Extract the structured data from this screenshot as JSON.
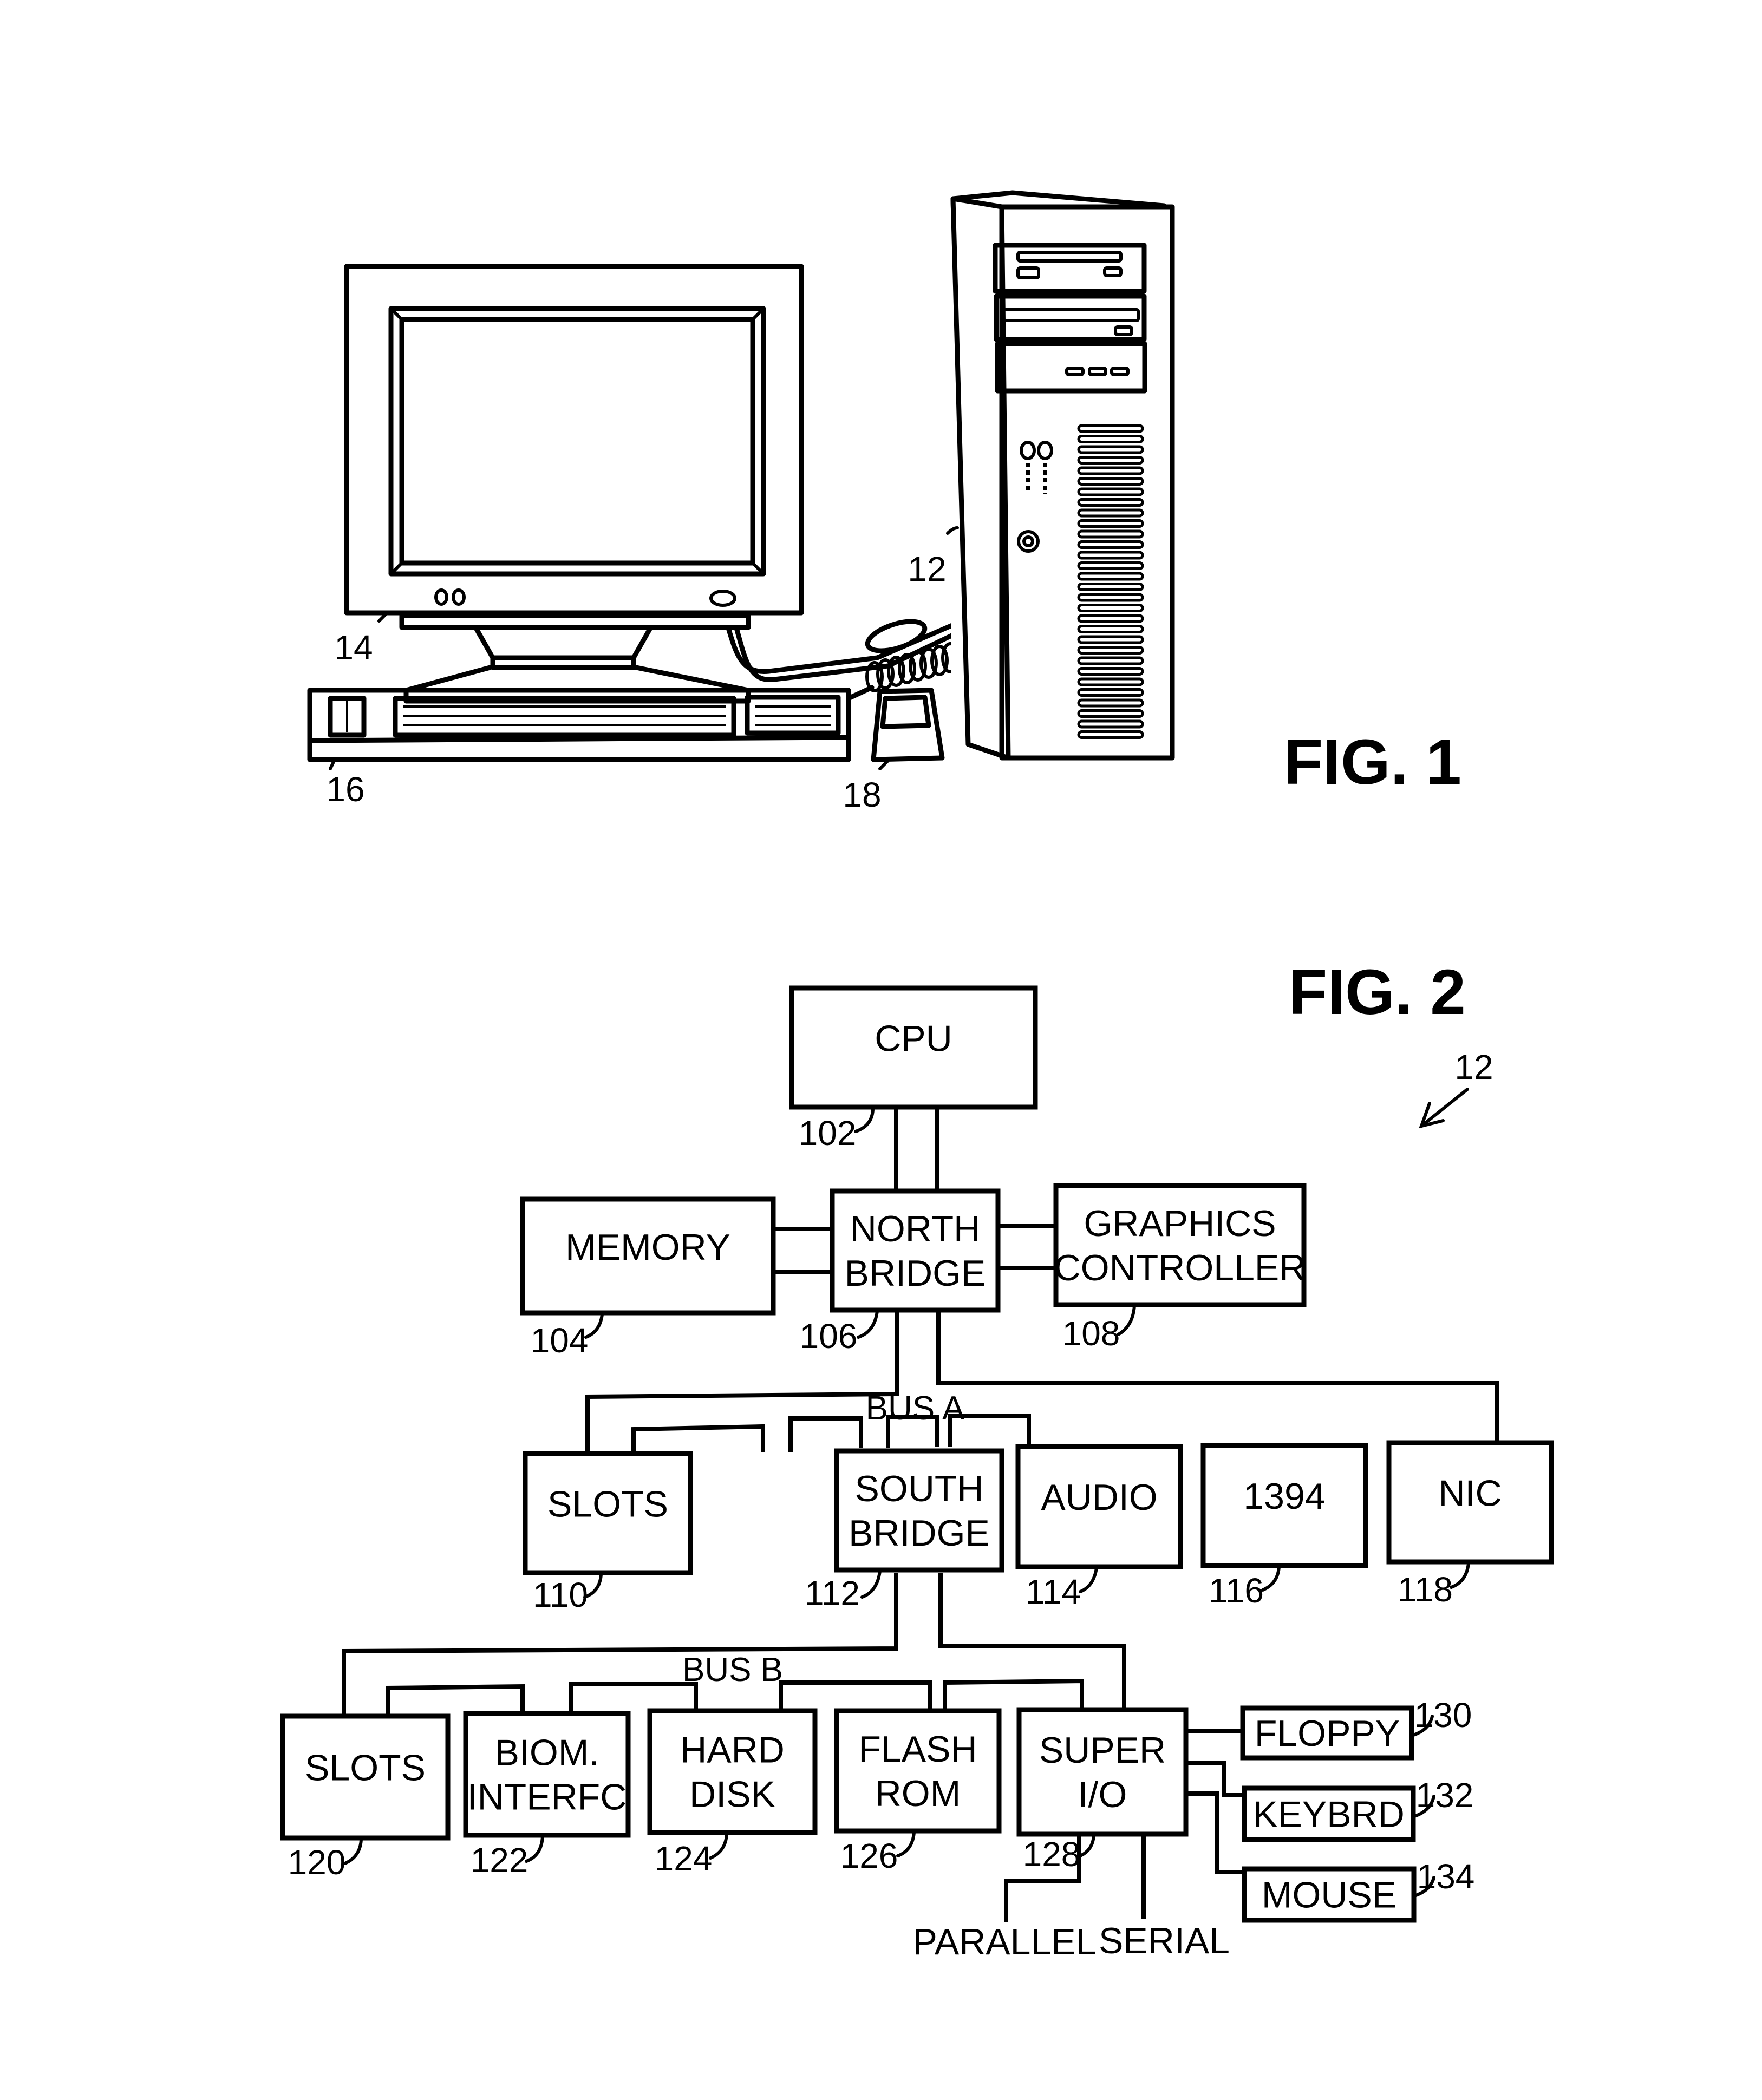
{
  "fig1": {
    "title": "FIG. 1",
    "refs": {
      "tower": "12",
      "monitor": "14",
      "keyboard": "16",
      "mouse": "18"
    }
  },
  "fig2": {
    "title": "FIG. 2",
    "system_ref": "12",
    "bus_a_label": "BUS A",
    "bus_b_label": "BUS B",
    "blocks": {
      "cpu": {
        "lines": [
          "CPU"
        ],
        "ref": "102"
      },
      "memory": {
        "lines": [
          "MEMORY"
        ],
        "ref": "104"
      },
      "north_bridge": {
        "lines": [
          "NORTH",
          "BRIDGE"
        ],
        "ref": "106"
      },
      "graphics": {
        "lines": [
          "GRAPHICS",
          "CONTROLLER"
        ],
        "ref": "108"
      },
      "slots_a": {
        "lines": [
          "SLOTS"
        ],
        "ref": "110"
      },
      "south_bridge": {
        "lines": [
          "SOUTH",
          "BRIDGE"
        ],
        "ref": "112"
      },
      "audio": {
        "lines": [
          "AUDIO"
        ],
        "ref": "114"
      },
      "ieee1394": {
        "lines": [
          "1394"
        ],
        "ref": "116"
      },
      "nic": {
        "lines": [
          "NIC"
        ],
        "ref": "118"
      },
      "slots_b": {
        "lines": [
          "SLOTS"
        ],
        "ref": "120"
      },
      "biometric": {
        "lines": [
          "BIOM.",
          "INTERFC"
        ],
        "ref": "122"
      },
      "hard_disk": {
        "lines": [
          "HARD",
          "DISK"
        ],
        "ref": "124"
      },
      "flash_rom": {
        "lines": [
          "FLASH",
          "ROM"
        ],
        "ref": "126"
      },
      "super_io": {
        "lines": [
          "SUPER",
          "I/O"
        ],
        "ref": "128"
      },
      "floppy": {
        "lines": [
          "FLOPPY"
        ],
        "ref": "130"
      },
      "keybrd": {
        "lines": [
          "KEYBRD"
        ],
        "ref": "132"
      },
      "mouse": {
        "lines": [
          "MOUSE"
        ],
        "ref": "134"
      }
    },
    "ports": {
      "parallel": "PARALLEL",
      "serial": "SERIAL"
    }
  }
}
